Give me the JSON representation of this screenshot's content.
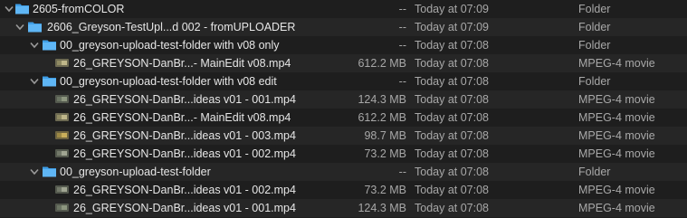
{
  "rows": [
    {
      "name": "2605-fromCOLOR",
      "size": "--",
      "date": "Today at 07:09",
      "kind": "Folder"
    },
    {
      "name": "2606_Greyson-TestUpl...d 002 - fromUPLOADER",
      "size": "--",
      "date": "Today at 07:09",
      "kind": "Folder"
    },
    {
      "name": "00_greyson-upload-test-folder with v08 only",
      "size": "--",
      "date": "Today at 07:08",
      "kind": "Folder"
    },
    {
      "name": "26_GREYSON-DanBr...- MainEdit v08.mp4",
      "size": "612.2 MB",
      "date": "Today at 07:08",
      "kind": "MPEG-4 movie"
    },
    {
      "name": "00_greyson-upload-test-folder with v08 edit",
      "size": "--",
      "date": "Today at 07:08",
      "kind": "Folder"
    },
    {
      "name": "26_GREYSON-DanBr...ideas v01 - 001.mp4",
      "size": "124.3 MB",
      "date": "Today at 07:08",
      "kind": "MPEG-4 movie"
    },
    {
      "name": "26_GREYSON-DanBr...- MainEdit v08.mp4",
      "size": "612.2 MB",
      "date": "Today at 07:08",
      "kind": "MPEG-4 movie"
    },
    {
      "name": "26_GREYSON-DanBr...ideas v01 - 003.mp4",
      "size": "98.7 MB",
      "date": "Today at 07:08",
      "kind": "MPEG-4 movie"
    },
    {
      "name": "26_GREYSON-DanBr...ideas v01 - 002.mp4",
      "size": "73.2 MB",
      "date": "Today at 07:08",
      "kind": "MPEG-4 movie"
    },
    {
      "name": "00_greyson-upload-test-folder",
      "size": "--",
      "date": "Today at 07:08",
      "kind": "Folder"
    },
    {
      "name": "26_GREYSON-DanBr...ideas v01 - 002.mp4",
      "size": "73.2 MB",
      "date": "Today at 07:08",
      "kind": "MPEG-4 movie"
    },
    {
      "name": "26_GREYSON-DanBr...ideas v01 - 001.mp4",
      "size": "124.3 MB",
      "date": "Today at 07:08",
      "kind": "MPEG-4 movie"
    }
  ],
  "colors": {
    "folder": "#4aa8f0",
    "background": "#1e1e1e",
    "alt_row": "#262626"
  }
}
